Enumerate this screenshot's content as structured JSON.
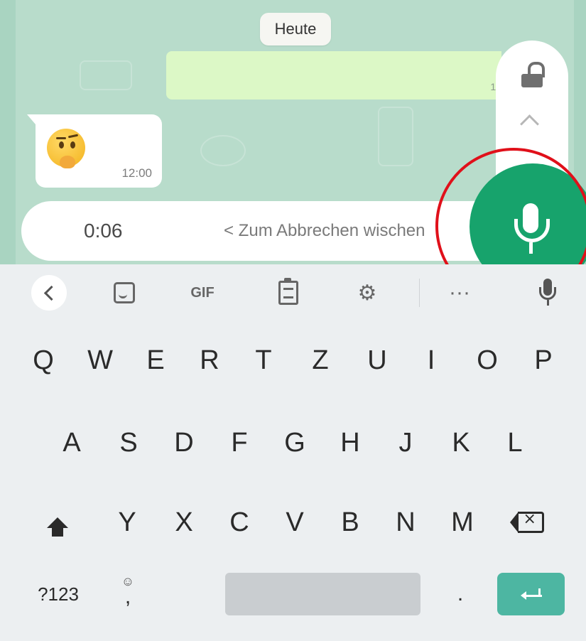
{
  "chat": {
    "date_label": "Heute",
    "outgoing_time_partial": "1:",
    "incoming_emoji": "thinking-face-emoji",
    "incoming_time": "12:00"
  },
  "recording": {
    "elapsed": "0:06",
    "cancel_hint": "< Zum Abbrechen wischen",
    "lock_icon": "unlock-icon",
    "mic_color": "#17a36c",
    "highlight_color": "#e0101a"
  },
  "keyboard_toolbar": {
    "back_icon": "chevron-left-icon",
    "sticker_icon": "sticker-icon",
    "gif_label": "GIF",
    "clipboard_icon": "clipboard-icon",
    "settings_icon": "gear-icon",
    "more_label": "···",
    "voice_icon": "mic-icon"
  },
  "keyboard": {
    "row1": [
      "Q",
      "W",
      "E",
      "R",
      "T",
      "Z",
      "U",
      "I",
      "O",
      "P"
    ],
    "row2": [
      "A",
      "S",
      "D",
      "F",
      "G",
      "H",
      "J",
      "K",
      "L"
    ],
    "row3": [
      "Y",
      "X",
      "C",
      "V",
      "B",
      "N",
      "M"
    ],
    "numbers_label": "?123",
    "emoji_hint": "☺",
    "comma_label": ",",
    "period_label": ".",
    "enter_color": "#4db6a2"
  }
}
